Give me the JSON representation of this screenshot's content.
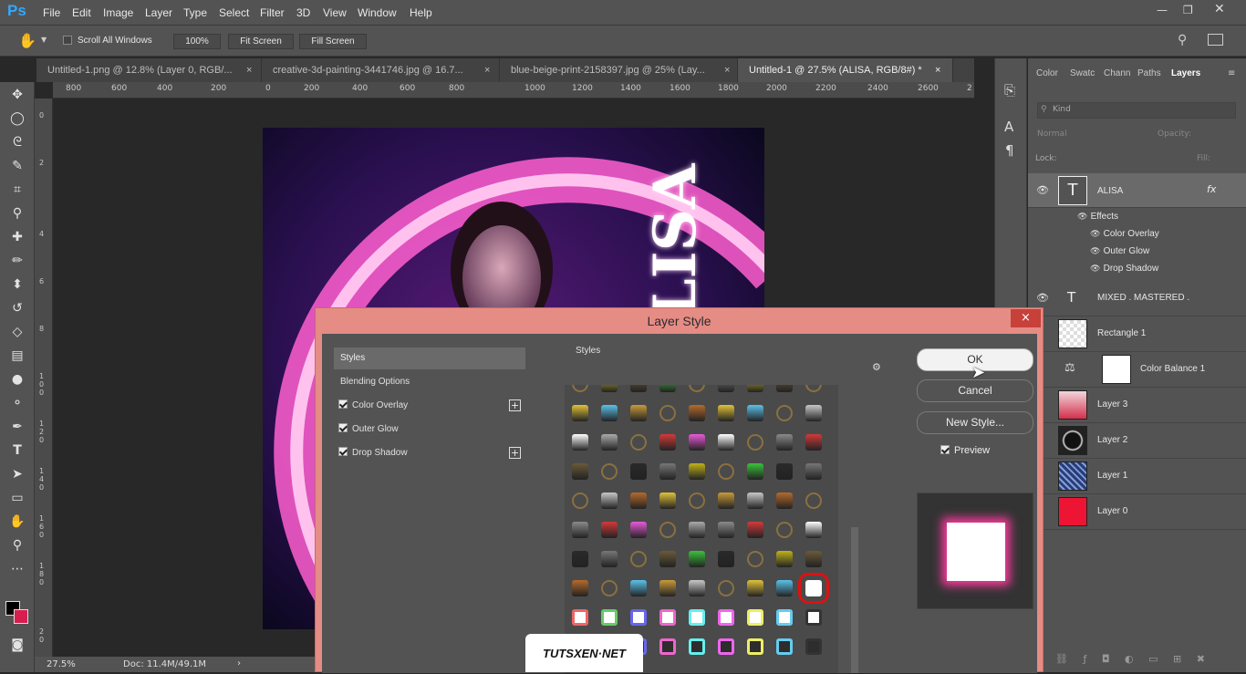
{
  "app": {
    "logo": "Ps"
  },
  "menu": [
    "File",
    "Edit",
    "Image",
    "Layer",
    "Type",
    "Select",
    "Filter",
    "3D",
    "View",
    "Window",
    "Help"
  ],
  "options": {
    "scroll_all_windows": "Scroll All Windows",
    "zoom_btn": "100%",
    "fit_screen": "Fit Screen",
    "fill_screen": "Fill Screen"
  },
  "tabs": [
    {
      "label": "Untitled-1.png @ 12.8% (Layer 0, RGB/...",
      "close": "×"
    },
    {
      "label": "creative-3d-painting-3441746.jpg @ 16.7...",
      "close": "×"
    },
    {
      "label": "blue-beige-print-2158397.jpg @ 25% (Lay...",
      "close": "×"
    },
    {
      "label": "Untitled-1 @ 27.5% (ALISA, RGB/8#) *",
      "close": "×"
    }
  ],
  "ruler_h": [
    "800",
    "600",
    "400",
    "200",
    "0",
    "200",
    "400",
    "600",
    "800",
    "1000",
    "1200",
    "1400",
    "1600",
    "1800",
    "2000",
    "2200",
    "2400",
    "2600",
    "2"
  ],
  "ruler_v": [
    "0",
    "2",
    "4",
    "6",
    "8",
    "1 0 0",
    "1 2 0",
    "1 4 0",
    "1 6 0",
    "1 8 0",
    "2 0"
  ],
  "status": {
    "zoom": "27.5%",
    "doc": "Doc: 11.4M/49.1M"
  },
  "panel_tabs": [
    "Color",
    "Swatc",
    "Chann",
    "Paths",
    "Layers"
  ],
  "layers_panel": {
    "kind": "Kind",
    "blend": "Normal",
    "opacity": "Opacity:",
    "lock": "Lock:",
    "fill": "Fill:",
    "layers": [
      {
        "name": "ALISA",
        "fx": "fx"
      },
      {
        "name": "Effects"
      },
      {
        "name": "Color Overlay"
      },
      {
        "name": "Outer Glow"
      },
      {
        "name": "Drop Shadow"
      },
      {
        "name": "MIXED . MASTERED ."
      },
      {
        "name": "Rectangle 1"
      },
      {
        "name": "Color Balance 1"
      },
      {
        "name": "Layer 3"
      },
      {
        "name": "Layer 2"
      },
      {
        "name": "Layer 1"
      },
      {
        "name": "Layer 0"
      }
    ]
  },
  "dialog": {
    "title": "Layer Style",
    "close": "×",
    "left": {
      "styles": "Styles",
      "blending": "Blending Options",
      "items": [
        "Color Overlay",
        "Outer Glow",
        "Drop Shadow"
      ]
    },
    "styles_header": "Styles",
    "ok": "OK",
    "cancel": "Cancel",
    "new_style": "New Style...",
    "preview": "Preview"
  },
  "canvas_text": "ALISA",
  "watermark": "TUTSXEN·NET",
  "colors": {
    "accent": "#31a8ff",
    "dialog_frame": "#e58c85",
    "selected_swatch_border": "#e01010",
    "layer0": "#ee1433"
  }
}
